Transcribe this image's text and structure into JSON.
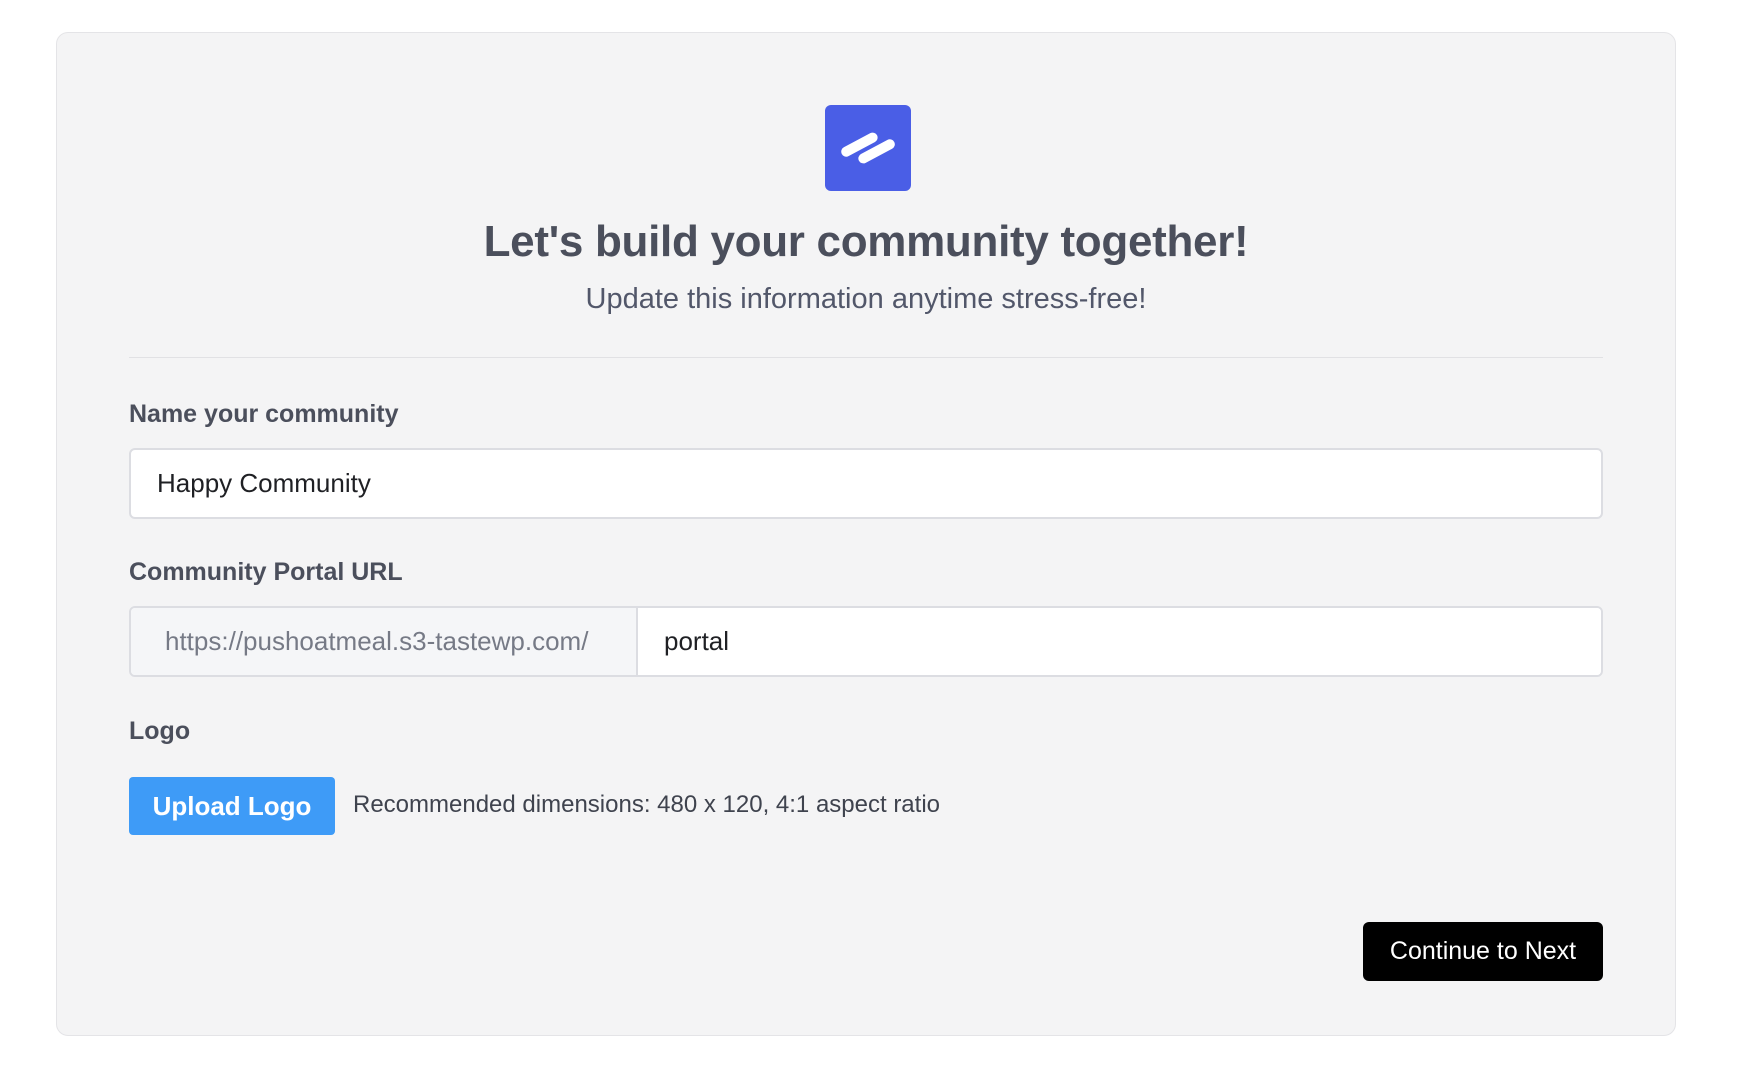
{
  "onboarding": {
    "brand_icon": "double-slash-logo-icon",
    "brand_color": "#4a5ee6",
    "title": "Let's build your community together!",
    "subtitle": "Update this information anytime stress-free!"
  },
  "form": {
    "name_label": "Name your community",
    "name_value": "Happy Community",
    "url_label": "Community Portal URL",
    "url_prefix": "https://pushoatmeal.s3-tastewp.com/",
    "url_slug": "portal",
    "logo_label": "Logo",
    "upload_button": "Upload Logo",
    "upload_color": "#3e9bf7",
    "logo_hint": "Recommended dimensions: 480 x 120, 4:1 aspect ratio"
  },
  "footer": {
    "continue_button": "Continue to Next"
  }
}
